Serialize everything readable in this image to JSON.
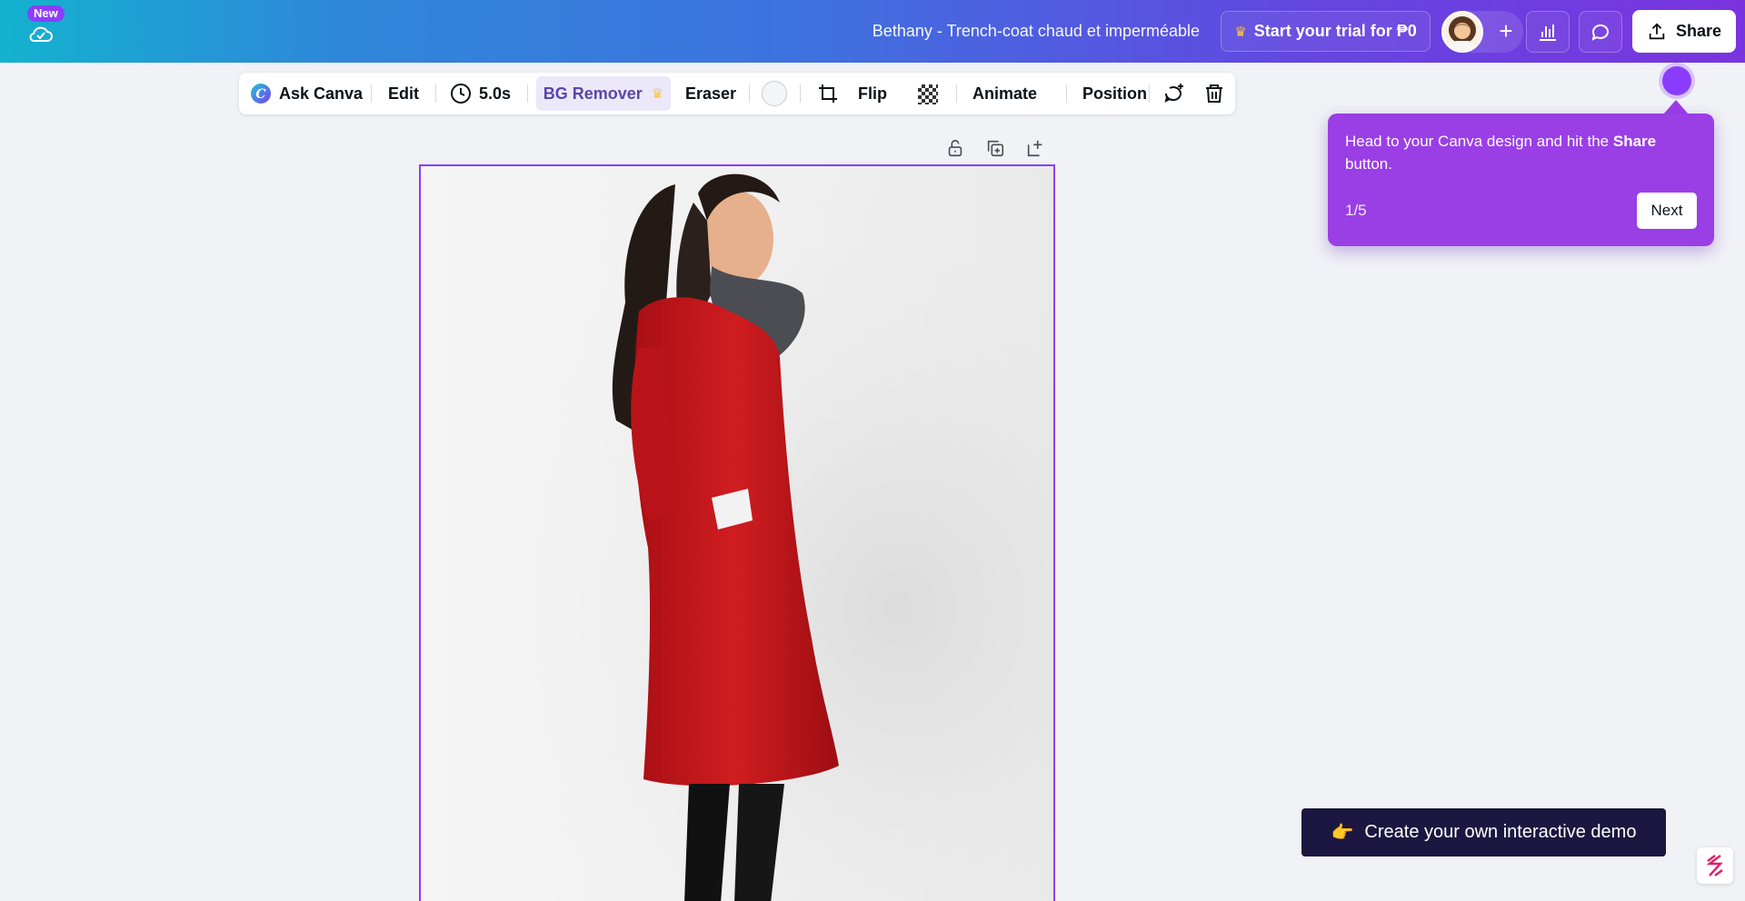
{
  "topbar": {
    "new_badge": "New",
    "doc_title": "Bethany - Trench-coat chaud et imperméable",
    "trial_label": "Start your trial for ₱0",
    "add_person": "+",
    "share_label": "Share"
  },
  "toolbar": {
    "ask_canva": "Ask Canva",
    "edit": "Edit",
    "duration": "5.0s",
    "bg_remover": "BG Remover",
    "eraser": "Eraser",
    "flip": "Flip",
    "animate": "Animate",
    "position": "Position"
  },
  "tooltip": {
    "text_before": "Head to your Canva design and hit the ",
    "text_bold": "Share",
    "text_after": " button.",
    "step": "1/5",
    "next": "Next"
  },
  "demo_cta": {
    "emoji": "👉",
    "label": "Create your own interactive demo"
  },
  "colors": {
    "accent": "#8b3dff",
    "tooltip_bg": "#9a3ee6",
    "cta_bg": "#1c1740",
    "coat_red": "#c8181b"
  }
}
